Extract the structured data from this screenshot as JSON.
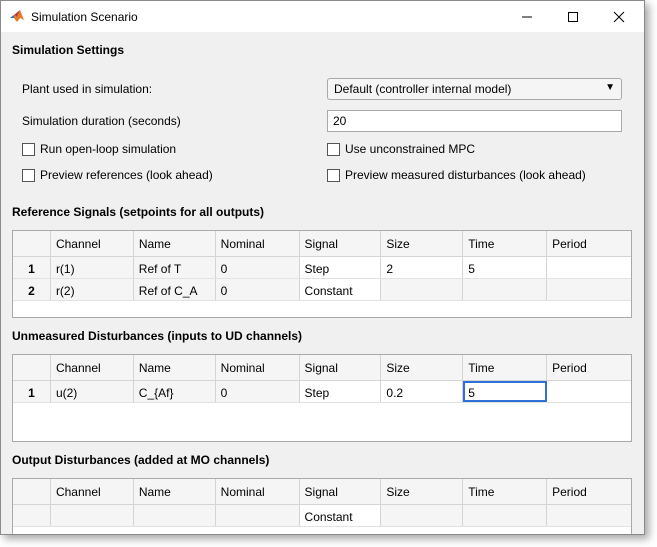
{
  "window": {
    "title": "Simulation Scenario",
    "icon": "matlab-icon",
    "minimize": "minimize-icon",
    "maximize": "maximize-icon",
    "close": "close-icon"
  },
  "settings": {
    "heading": "Simulation Settings",
    "plant_label": "Plant used in simulation:",
    "plant_value": "Default (controller internal model)",
    "duration_label": "Simulation duration (seconds)",
    "duration_value": "20",
    "open_loop_label": "Run open-loop simulation",
    "open_loop_checked": false,
    "unconstrained_label": "Use unconstrained MPC",
    "unconstrained_checked": false,
    "preview_refs_label": "Preview references (look ahead)",
    "preview_refs_checked": false,
    "preview_md_label": "Preview measured disturbances (look ahead)",
    "preview_md_checked": false
  },
  "columns": [
    "",
    "Channel",
    "Name",
    "Nominal",
    "Signal",
    "Size",
    "Time",
    "Period"
  ],
  "reference": {
    "heading": "Reference Signals (setpoints for all outputs)",
    "rows": [
      [
        "1",
        "r(1)",
        "Ref of T",
        "0",
        "Step",
        "2",
        "5",
        ""
      ],
      [
        "2",
        "r(2)",
        "Ref of C_A",
        "0",
        "Constant",
        "",
        "",
        ""
      ]
    ]
  },
  "unmeasured": {
    "heading": "Unmeasured Disturbances (inputs to UD channels)",
    "rows": [
      [
        "1",
        "u(2)",
        "C_{Af}",
        "0",
        "Step",
        "0.2",
        "5",
        ""
      ]
    ]
  },
  "output": {
    "heading": "Output Disturbances (added at MO channels)",
    "partial_row_signal": "Constant"
  }
}
